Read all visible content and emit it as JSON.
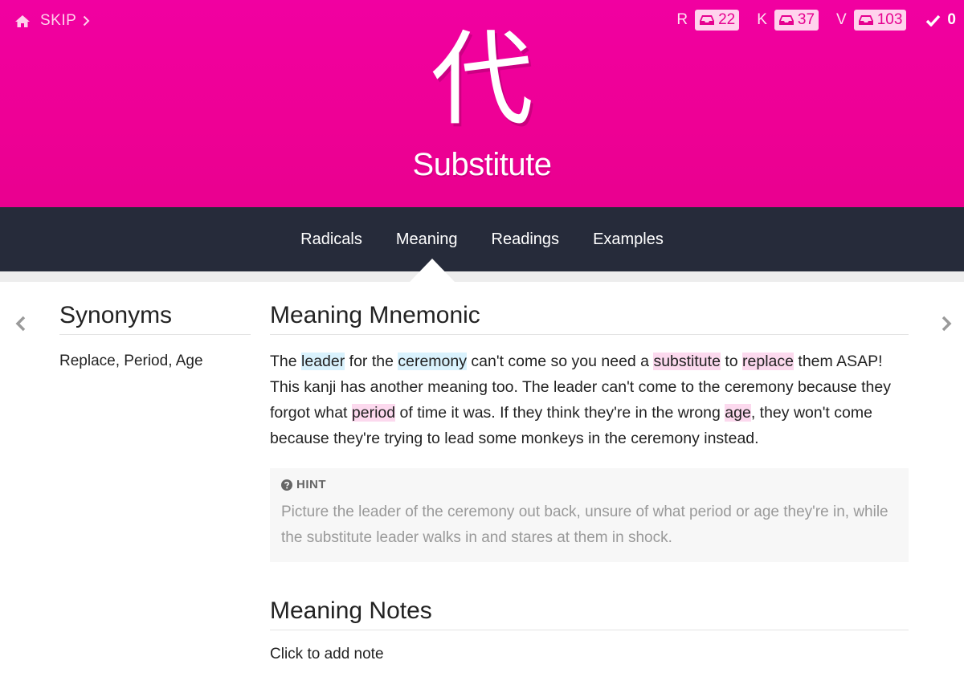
{
  "topbar": {
    "skip_label": "SKIP",
    "counts": [
      {
        "letter": "R",
        "value": "22"
      },
      {
        "letter": "K",
        "value": "37"
      },
      {
        "letter": "V",
        "value": "103"
      }
    ],
    "done_count": "0"
  },
  "character": {
    "kanji": "代",
    "meaning": "Substitute"
  },
  "nav": {
    "tabs": [
      "Radicals",
      "Meaning",
      "Readings",
      "Examples"
    ],
    "active": "Meaning"
  },
  "sidebar": {
    "title": "Synonyms",
    "synonyms": "Replace, Period, Age"
  },
  "mnemonic": {
    "title": "Meaning Mnemonic",
    "text": {
      "t1": "The ",
      "r1": "leader",
      "t2": " for the ",
      "r2": "ceremony",
      "t3": " can't come so you need a ",
      "k1": "substitute",
      "t4": " to ",
      "k2": "replace",
      "t5": " them ASAP! This kanji has another meaning too. The leader can't come to the ceremony because they forgot what ",
      "k3": "period",
      "t6": " of time it was. If they think they're in the wrong ",
      "k4": "age",
      "t7": ", they won't come because they're trying to lead some monkeys in the ceremony instead."
    }
  },
  "hint": {
    "label": "HINT",
    "text": "Picture the leader of the ceremony out back, unsure of what period or age they're in, while the substitute leader walks in and stares at them in shock."
  },
  "notes": {
    "title": "Meaning Notes",
    "add_label": "Click to add note"
  },
  "colors": {
    "header": "#ee0095",
    "nav": "#262b3a",
    "radical_highlight": "#d9f2fd",
    "kanji_highlight": "#fcd9ee"
  }
}
